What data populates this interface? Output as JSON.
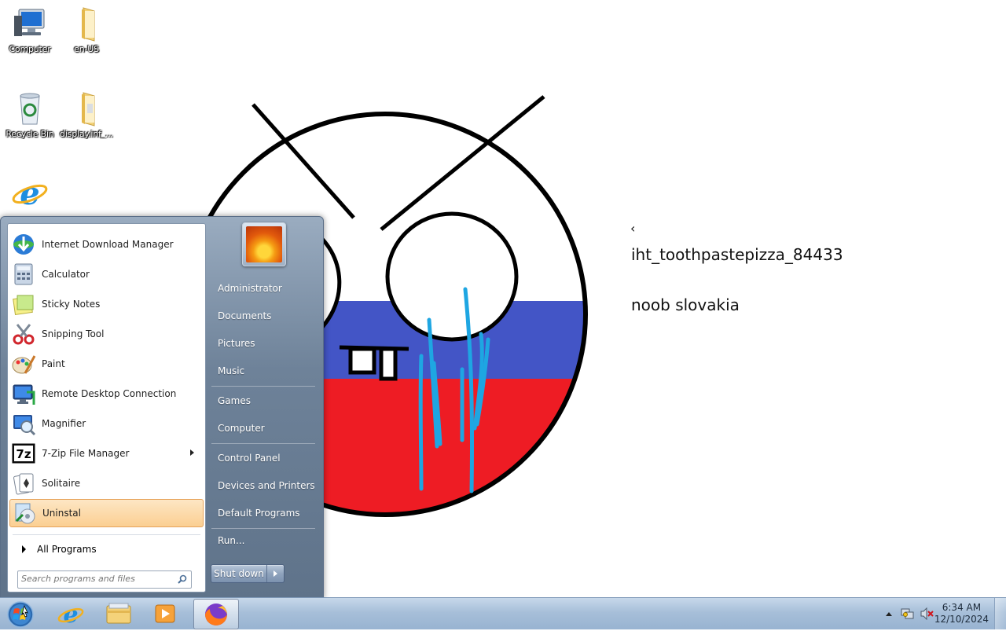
{
  "desktop": {
    "icons": [
      {
        "label": "Computer"
      },
      {
        "label": "en-US"
      },
      {
        "label": "Recycle Bin"
      },
      {
        "label": "display.inf_..."
      },
      {
        "label": ""
      }
    ],
    "wallpaper_text": {
      "mark": "‹",
      "line1": "iht_toothpastepizza_84433",
      "line2": "noob slovakia"
    },
    "colors": {
      "flag_blue": "#4355c6",
      "flag_red": "#ee1c24",
      "tears": "#1ea6e2"
    }
  },
  "start_menu": {
    "programs": [
      {
        "label": "Internet Download Manager",
        "icon": "idm-icon"
      },
      {
        "label": "Calculator",
        "icon": "calculator-icon"
      },
      {
        "label": "Sticky Notes",
        "icon": "sticky-notes-icon"
      },
      {
        "label": "Snipping Tool",
        "icon": "snipping-tool-icon"
      },
      {
        "label": "Paint",
        "icon": "paint-icon"
      },
      {
        "label": "Remote Desktop Connection",
        "icon": "remote-desktop-icon"
      },
      {
        "label": "Magnifier",
        "icon": "magnifier-icon"
      },
      {
        "label": "7-Zip File Manager",
        "icon": "seven-zip-icon",
        "icon_text": "7z"
      },
      {
        "label": "Solitaire",
        "icon": "solitaire-icon"
      },
      {
        "label": "Uninstal",
        "icon": "uninstall-icon"
      }
    ],
    "all_programs": "All Programs",
    "search_placeholder": "Search programs and files",
    "right_items": [
      "Administrator",
      "Documents",
      "Pictures",
      "Music",
      "Games",
      "Computer",
      "Control Panel",
      "Devices and Printers",
      "Default Programs",
      "Run..."
    ],
    "shutdown_label": "Shut down"
  },
  "taskbar": {
    "apps": [
      "start-orb-icon",
      "internet-explorer-icon",
      "windows-explorer-icon",
      "media-player-icon",
      "firefox-icon"
    ],
    "clock": {
      "time": "6:34 AM",
      "date": "12/10/2024"
    }
  }
}
